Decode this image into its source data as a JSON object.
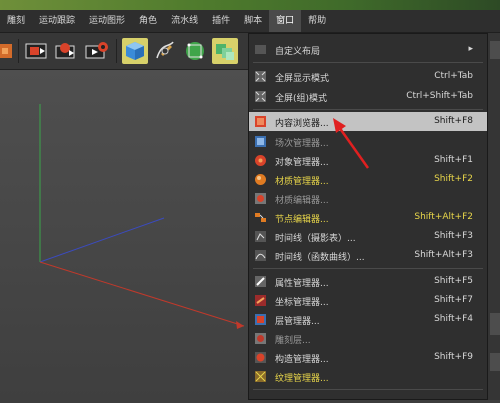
{
  "menubar": {
    "items": [
      {
        "label": "雕刻"
      },
      {
        "label": "运动跟踪"
      },
      {
        "label": "运动图形"
      },
      {
        "label": "角色"
      },
      {
        "label": "流水线"
      },
      {
        "label": "插件"
      },
      {
        "label": "脚本"
      },
      {
        "label": "窗口",
        "active": true
      },
      {
        "label": "帮助"
      }
    ]
  },
  "window_menu": {
    "items": [
      {
        "label": "自定义布局",
        "shortcut": "",
        "submenu": true
      },
      {
        "label": "全屏显示模式",
        "shortcut": "Ctrl+Tab"
      },
      {
        "label": "全屏(组)模式",
        "shortcut": "Ctrl+Shift+Tab"
      },
      {
        "label": "内容浏览器...",
        "shortcut": "Shift+F8",
        "highlighted": true
      },
      {
        "label": "场次管理器...",
        "shortcut": ""
      },
      {
        "label": "对象管理器...",
        "shortcut": "Shift+F1"
      },
      {
        "label": "材质管理器...",
        "shortcut": "Shift+F2",
        "yellow": true
      },
      {
        "label": "材质编辑器...",
        "shortcut": ""
      },
      {
        "label": "节点编辑器...",
        "shortcut": "Shift+Alt+F2",
        "yellow": true
      },
      {
        "label": "时间线（摄影表）...",
        "shortcut": "Shift+F3"
      },
      {
        "label": "时间线（函数曲线）...",
        "shortcut": "Shift+Alt+F3"
      },
      {
        "label": "属性管理器...",
        "shortcut": "Shift+F5"
      },
      {
        "label": "坐标管理器...",
        "shortcut": "Shift+F7"
      },
      {
        "label": "层管理器...",
        "shortcut": "Shift+F4"
      },
      {
        "label": "雕刻层...",
        "shortcut": ""
      },
      {
        "label": "构造管理器...",
        "shortcut": "Shift+F9"
      },
      {
        "label": "纹理管理器...",
        "shortcut": "",
        "yellow": true
      }
    ]
  },
  "colors": {
    "accent_highlight": "#c3c3c3",
    "yellow_text": "#e8d64a",
    "annotation_arrow": "#e02020",
    "axis_x": "#c0392b",
    "axis_y": "#3aa64a",
    "axis_z": "#3b4bbf"
  }
}
